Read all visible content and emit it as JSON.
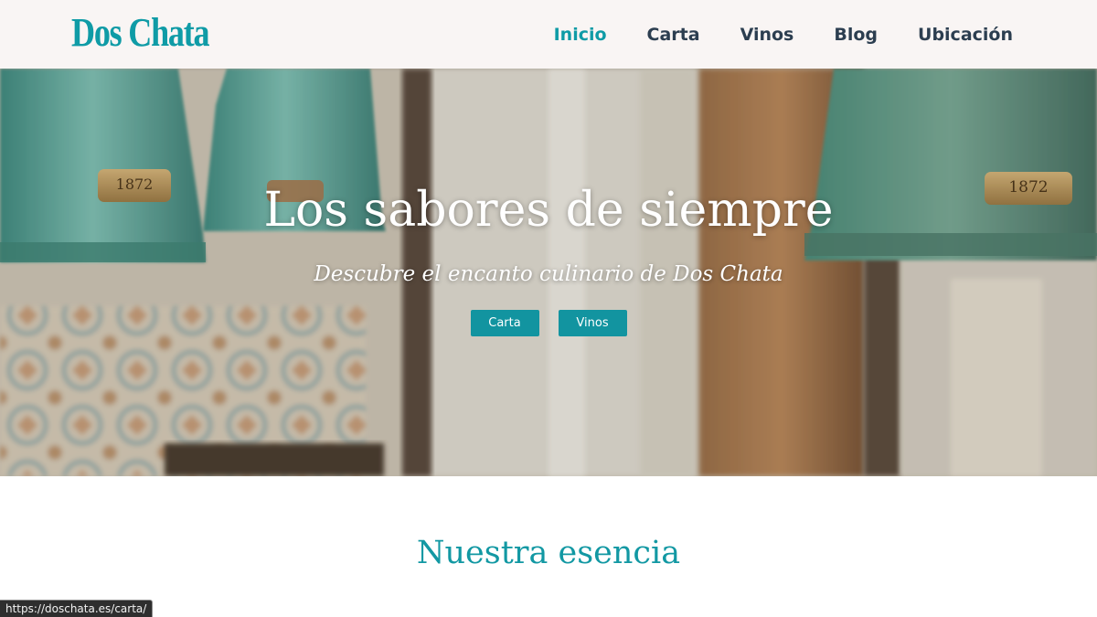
{
  "brand": {
    "logo_text": "Dos Chata",
    "accent_color": "#0f9ba6"
  },
  "nav": {
    "items": [
      {
        "label": "Inicio",
        "active": true
      },
      {
        "label": "Carta",
        "active": false
      },
      {
        "label": "Vinos",
        "active": false
      },
      {
        "label": "Blog",
        "active": false
      },
      {
        "label": "Ubicación",
        "active": false
      }
    ]
  },
  "hero": {
    "title": "Los sabores de siempre",
    "subtitle": "Descubre el encanto culinario de Dos Chata",
    "buttons": [
      {
        "label": "Carta"
      },
      {
        "label": "Vinos"
      }
    ],
    "lamp_plate_text": "1872"
  },
  "section": {
    "title": "Nuestra esencia"
  },
  "status_bar": {
    "url": "https://doschata.es/carta/"
  }
}
